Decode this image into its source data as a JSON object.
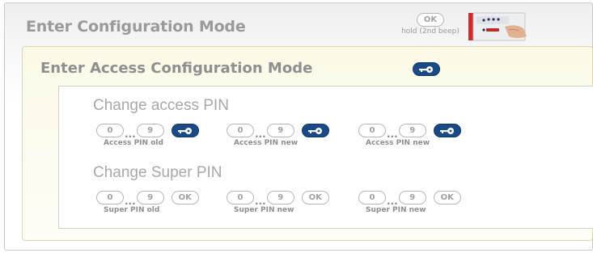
{
  "header": {
    "title": "Enter Configuration Mode",
    "ok_key": "OK",
    "ok_caption": "hold (2nd beep)"
  },
  "access_mode": {
    "title": "Enter Access Configuration Mode",
    "icon": "key-icon"
  },
  "change_access_pin": {
    "title": "Change access PIN",
    "combos": [
      {
        "first_key": "0",
        "ellipsis": "...",
        "last_key": "9",
        "confirm_icon": "key-icon",
        "label": "Access PIN old"
      },
      {
        "first_key": "0",
        "ellipsis": "...",
        "last_key": "9",
        "confirm_icon": "key-icon",
        "label": "Access PIN new"
      },
      {
        "first_key": "0",
        "ellipsis": "...",
        "last_key": "9",
        "confirm_icon": "key-icon",
        "label": "Access PIN new"
      }
    ]
  },
  "change_super_pin": {
    "title": "Change Super PIN",
    "combos": [
      {
        "first_key": "0",
        "ellipsis": "...",
        "last_key": "9",
        "confirm_key": "OK",
        "label": "Super PIN old"
      },
      {
        "first_key": "0",
        "ellipsis": "...",
        "last_key": "9",
        "confirm_key": "OK",
        "label": "Super PIN new"
      },
      {
        "first_key": "0",
        "ellipsis": "...",
        "last_key": "9",
        "confirm_key": "OK",
        "label": "Super PIN new"
      }
    ]
  },
  "colors": {
    "key_blue": "#1a4a86",
    "title_gray": "#9a9a9a",
    "inner_bg": "#fcf9e7"
  }
}
